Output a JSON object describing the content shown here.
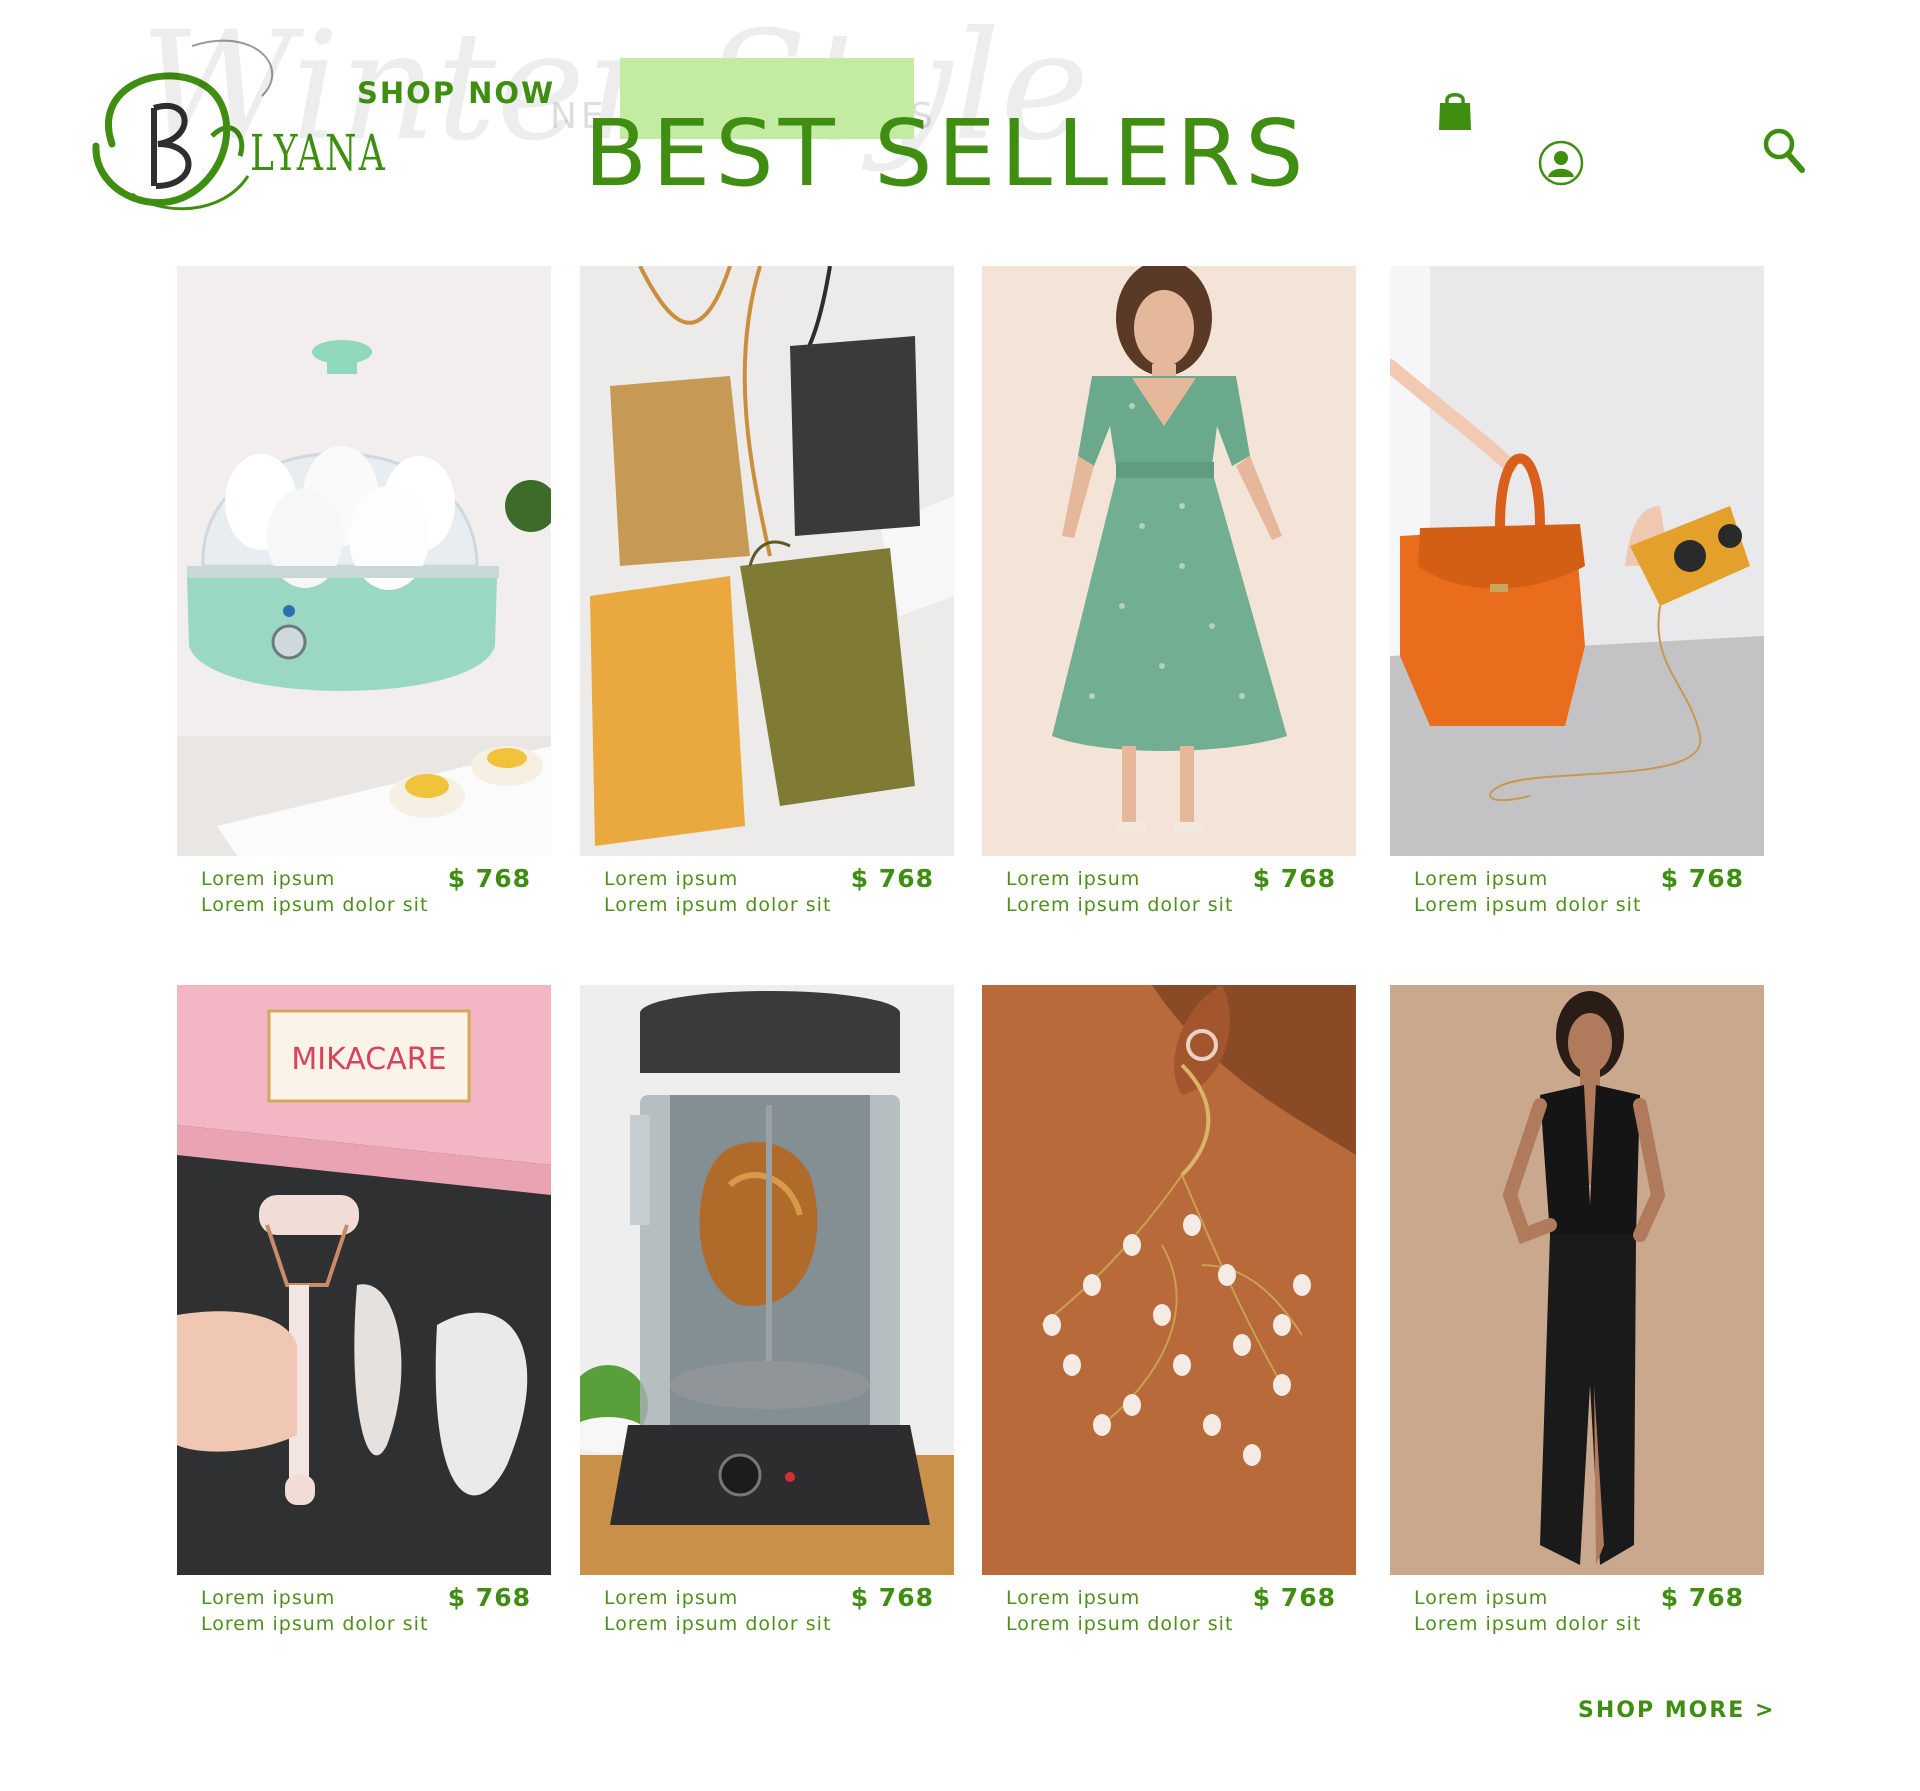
{
  "header": {
    "brand": "LYANA",
    "shop_now": "SHOP NOW",
    "title": "BEST SELLERS",
    "icons": [
      "shopping-bag-icon",
      "account-icon",
      "search-icon"
    ]
  },
  "colors": {
    "brand_green": "#3f8e12",
    "text_green": "#4f8f1c",
    "highlight": "#c3eca2",
    "background": "#ffffff"
  },
  "products": [
    {
      "image": "egg-cooker-photo",
      "name": "Lorem ipsum",
      "desc": "Lorem ipsum dolor sit",
      "price": "$ 768"
    },
    {
      "image": "leather-crossbody-bags-photo",
      "name": "Lorem ipsum",
      "desc": "Lorem ipsum dolor sit",
      "price": "$ 768"
    },
    {
      "image": "green-floral-dress-photo",
      "name": "Lorem ipsum",
      "desc": "Lorem ipsum dolor sit",
      "price": "$ 768"
    },
    {
      "image": "orange-handbag-and-clutch-photo",
      "name": "Lorem ipsum",
      "desc": "Lorem ipsum dolor sit",
      "price": "$ 768"
    },
    {
      "image": "rose-quartz-roller-set-photo",
      "name": "Lorem ipsum",
      "desc": "Lorem ipsum dolor sit",
      "price": "$ 768",
      "box_label": "MIKACARE"
    },
    {
      "image": "rotisserie-oven-photo",
      "name": "Lorem ipsum",
      "desc": "Lorem ipsum dolor sit",
      "price": "$ 768"
    },
    {
      "image": "pearl-cluster-earring-photo",
      "name": "Lorem ipsum",
      "desc": "Lorem ipsum dolor sit",
      "price": "$ 768"
    },
    {
      "image": "black-halter-gown-photo",
      "name": "Lorem ipsum",
      "desc": "Lorem ipsum dolor sit",
      "price": "$ 768"
    }
  ],
  "footer": {
    "shop_more": "SHOP MORE >"
  }
}
